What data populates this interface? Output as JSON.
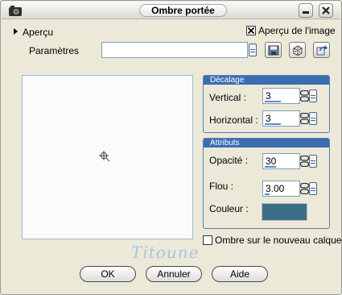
{
  "window": {
    "title": "Ombre portée",
    "minimize_icon": "minimize-icon",
    "close_icon": "close-icon",
    "app_icon": "camera-icon"
  },
  "top": {
    "preview_toggle_label": "Aperçu",
    "image_preview_label": "Aperçu de l'image",
    "image_preview_checked": true,
    "presets_label": "Paramètres",
    "preset_value": "",
    "preset_buttons": [
      "save-icon",
      "dice-icon",
      "reset-icon"
    ]
  },
  "offset_group": {
    "title": "Décalage",
    "vertical_label": "Vertical :",
    "vertical_value": "3",
    "horizontal_label": "Horizontal :",
    "horizontal_value": "3"
  },
  "attributes_group": {
    "title": "Attributs",
    "opacity_label": "Opacité :",
    "opacity_value": "30",
    "blur_label": "Flou :",
    "blur_value": "3.00",
    "color_label": "Couleur :",
    "color_hex": "#3c6e88"
  },
  "shadow_new_layer": {
    "label": "Ombre sur le nouveau calque",
    "checked": false
  },
  "watermark_text": "Titoune",
  "buttons": {
    "ok": "OK",
    "cancel": "Annuler",
    "help": "Aide"
  }
}
